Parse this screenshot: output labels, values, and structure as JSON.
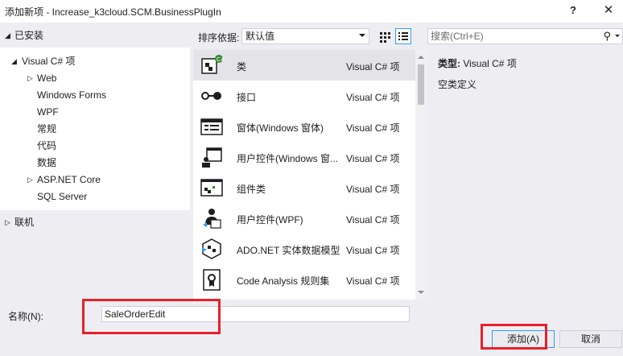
{
  "window": {
    "title": "添加新项 - Increase_k3cloud.SCM.BusinessPlugIn",
    "help": "?",
    "close": "✕"
  },
  "tree": {
    "installed": "已安装",
    "root": "Visual C# 项",
    "children": [
      "Web",
      "Windows Forms",
      "WPF",
      "常规",
      "代码",
      "数据",
      "ASP.NET Core",
      "SQL Server"
    ],
    "online": "联机"
  },
  "sort": {
    "label": "排序依据:",
    "value": "默认值"
  },
  "search": {
    "placeholder": "搜索(Ctrl+E)"
  },
  "templates": [
    {
      "name": "类",
      "type": "Visual C# 项"
    },
    {
      "name": "接口",
      "type": "Visual C# 项"
    },
    {
      "name": "窗体(Windows 窗体)",
      "type": "Visual C# 项"
    },
    {
      "name": "用户控件(Windows 窗...",
      "type": "Visual C# 项"
    },
    {
      "name": "组件类",
      "type": "Visual C# 项"
    },
    {
      "name": "用户控件(WPF)",
      "type": "Visual C# 项"
    },
    {
      "name": "ADO.NET 实体数据模型",
      "type": "Visual C# 项"
    },
    {
      "name": "Code Analysis 规则集",
      "type": "Visual C# 项"
    }
  ],
  "details": {
    "type_label": "类型:",
    "type_value": "Visual C# 项",
    "description": "空类定义"
  },
  "name_field": {
    "label": "名称(N):",
    "value": "SaleOrderEdit"
  },
  "buttons": {
    "add": "添加(A)",
    "cancel": "取消"
  },
  "colors": {
    "highlight": "#e8202a",
    "accent": "#3399ff",
    "icon_dark": "#1e1e1e",
    "icon_green": "#388a34"
  }
}
